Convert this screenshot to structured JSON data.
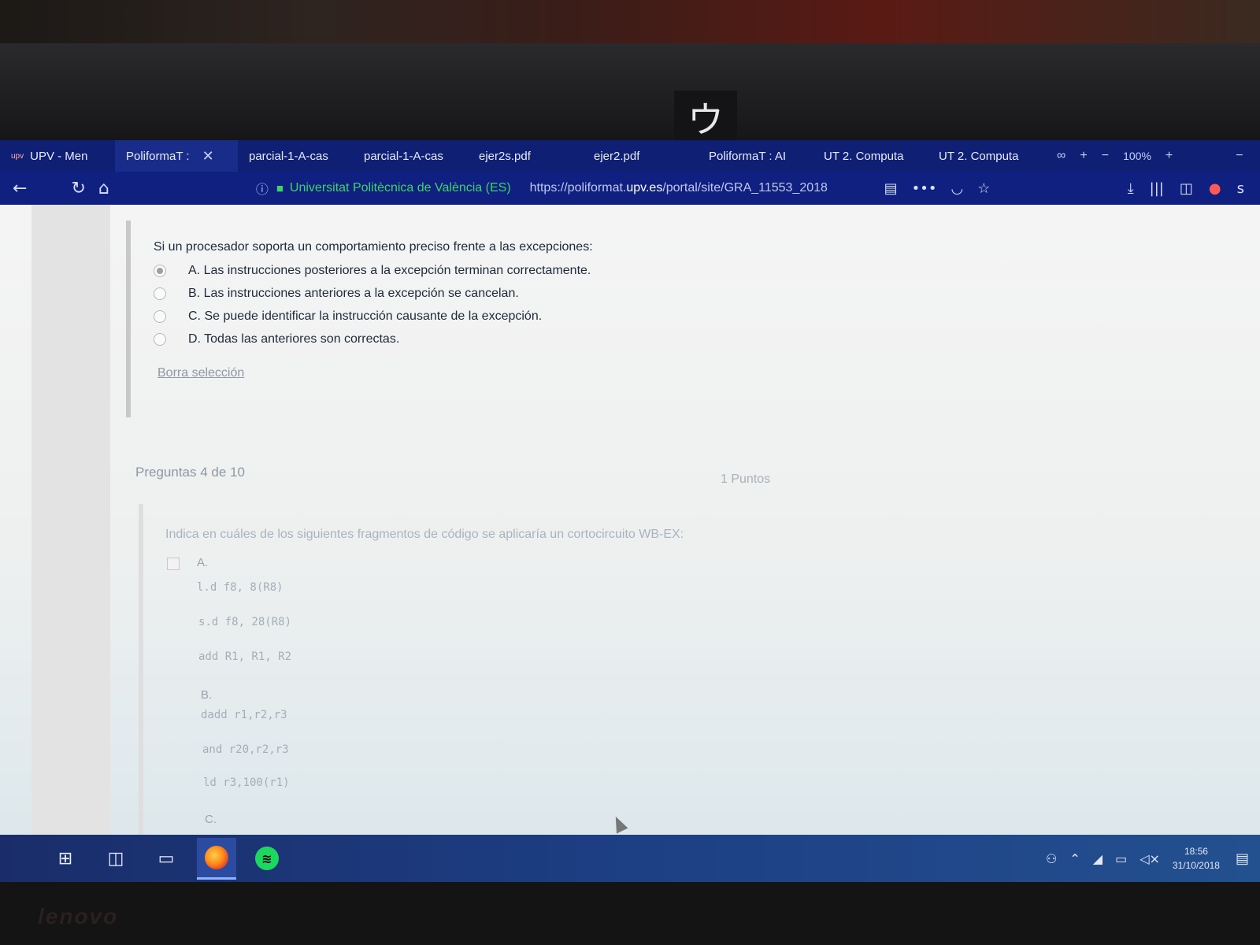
{
  "browser": {
    "tabs": [
      {
        "favicon": "upv",
        "label": "UPV - Men"
      },
      {
        "label": "PoliformaT :",
        "close": "✕"
      },
      {
        "label": "parcial-1-A-cas"
      },
      {
        "label": "parcial-1-A-cas"
      },
      {
        "label": "ejer2s.pdf"
      },
      {
        "label": "ejer2.pdf"
      },
      {
        "label": "PoliformaT : AI"
      },
      {
        "label": "UT 2. Computa"
      },
      {
        "label": "UT 2. Computa"
      }
    ],
    "zoom": "100%",
    "identity": "Universitat Politècnica de València (ES)",
    "url_prefix": "https://poliformat.",
    "url_domain": "upv.es",
    "url_path": "/portal/site/GRA_11553_2018"
  },
  "question1": {
    "text": "Si un procesador soporta un comportamiento preciso frente a las excepciones:",
    "options": [
      "A. Las instrucciones posteriores a la excepción terminan correctamente.",
      "B. Las instrucciones anteriores a la excepción se cancelan.",
      "C. Se puede identificar la instrucción causante de la excepción.",
      "D. Todas las anteriores son correctas."
    ],
    "selected_index": 0,
    "clear_label": "Borra selección"
  },
  "question2": {
    "counter": "Preguntas 4 de 10",
    "points": "1 Puntos",
    "text": "Indica en cuáles de los siguientes fragmentos de código se aplicaría un cortocircuito WB-EX:",
    "option_a_label": "A.",
    "option_a_code": [
      "l.d f8, 8(R8)",
      "s.d f8, 28(R8)",
      "add R1, R1, R2"
    ],
    "option_b_label": "B.",
    "option_b_code": [
      "dadd r1,r2,r3",
      "and r20,r2,r3",
      "ld r3,100(r1)"
    ],
    "option_c_label": "C."
  },
  "taskbar": {
    "time": "18:56",
    "date": "31/10/2018"
  },
  "hardware": {
    "webcam_glyph": "ウ",
    "brand": "lenovo"
  }
}
